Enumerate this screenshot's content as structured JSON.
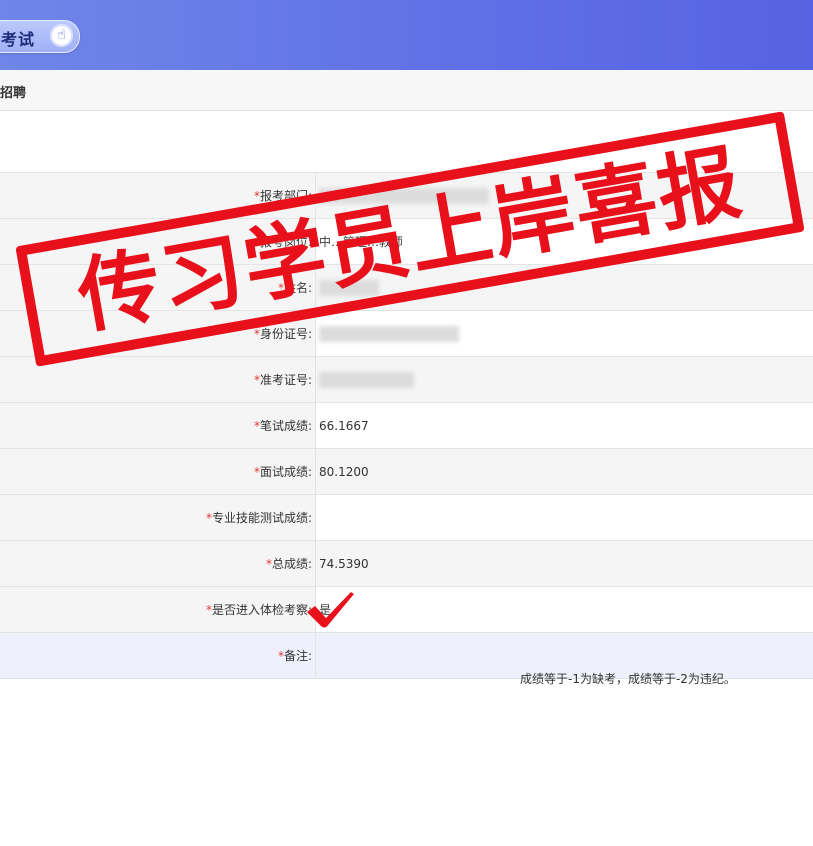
{
  "header": {
    "title_fragment": "考试",
    "hand_icon": "pointing-hand-icon"
  },
  "breadcrumb": {
    "text": "招聘"
  },
  "form": {
    "rows": [
      {
        "label": "报考部门:",
        "value": "",
        "redacted": true
      },
      {
        "label": "报考岗位:",
        "value": "中…管理…教师",
        "redacted": true
      },
      {
        "label": "姓名:",
        "value": "",
        "redacted": true
      },
      {
        "label": "身份证号:",
        "value": "",
        "redacted": true
      },
      {
        "label": "准考证号:",
        "value": "",
        "redacted": true
      },
      {
        "label": "笔试成绩:",
        "value": "66.1667"
      },
      {
        "label": "面试成绩:",
        "value": "80.1200"
      },
      {
        "label": "专业技能测试成绩:",
        "value": ""
      },
      {
        "label": "总成绩:",
        "value": "74.5390"
      },
      {
        "label": "是否进入体检考察:",
        "value": "是"
      },
      {
        "label": "备注:",
        "value": ""
      }
    ],
    "required_mark": "*"
  },
  "footnote": "成绩等于-1为缺考，成绩等于-2为违纪。",
  "stamp": {
    "text": "传习学员上岸喜报",
    "color": "#e8101a"
  },
  "checkmark": "checkmark-icon",
  "colors": {
    "header_start": "#6f86e8",
    "header_end": "#5663e2",
    "required": "#e53935"
  }
}
